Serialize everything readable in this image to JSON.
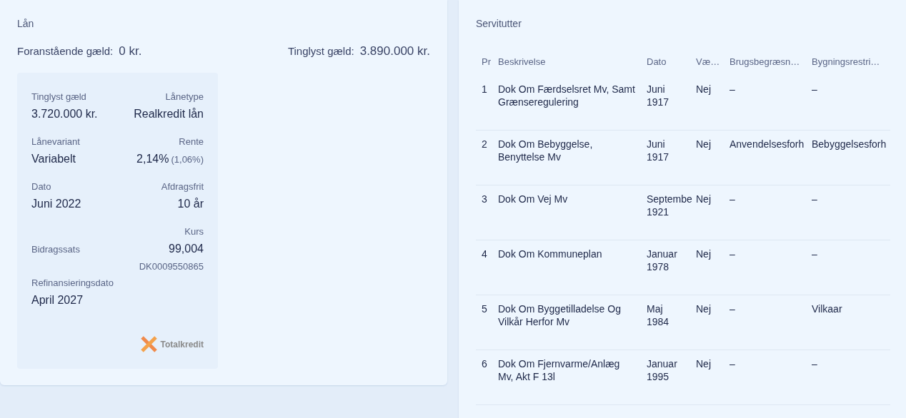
{
  "loan": {
    "title": "Lån",
    "summary": [
      {
        "label": "Foranstående gæld:",
        "value": "0 kr."
      },
      {
        "label": "Tinglyst gæld:",
        "value": "3.890.000 kr."
      }
    ],
    "details": [
      {
        "left": {
          "label": "Tinglyst gæld",
          "value": "3.720.000 kr."
        },
        "right": {
          "label": "Lånetype",
          "value": "Realkredit lån"
        }
      },
      {
        "left": {
          "label": "Lånevariant",
          "value": "Variabelt"
        },
        "right": {
          "label": "Rente",
          "value": "2,14%",
          "note": "(1,06%)"
        }
      },
      {
        "left": {
          "label": "Dato",
          "value": "Juni 2022"
        },
        "right": {
          "label": "Afdragsfrit",
          "value": "10 år"
        }
      },
      {
        "left": {
          "label": "Bidragssats"
        },
        "right": {
          "label": "Kurs",
          "value": "99,004",
          "sub": "DK0009550865"
        }
      },
      {
        "left": {
          "label": "Refinansieringsdato",
          "value": "April 2027"
        }
      }
    ],
    "lender": "Totalkredit"
  },
  "easements": {
    "title": "Servitutter",
    "columns": [
      "Pr",
      "Beskrivelse",
      "Dato",
      "Væ…",
      "Brugsbegræsn…",
      "Bygningsrestri…"
    ],
    "rows": [
      [
        "1",
        "Dok Om Færdselsret Mv, Samt Grænseregulering",
        "Juni 1917",
        "Nej",
        "–",
        "–"
      ],
      [
        "2",
        "Dok Om Bebyggelse, Benyttelse Mv",
        "Juni 1917",
        "Nej",
        "Anvendelsesforh",
        "Bebyggelsesforh"
      ],
      [
        "3",
        "Dok Om Vej Mv",
        "Septembe 1921",
        "Nej",
        "–",
        "–"
      ],
      [
        "4",
        "Dok Om Kommuneplan",
        "Januar 1978",
        "Nej",
        "–",
        "–"
      ],
      [
        "5",
        "Dok Om Byggetilladelse Og Vilkår Herfor Mv",
        "Maj 1984",
        "Nej",
        "–",
        "Vilkaar"
      ],
      [
        "6",
        "Dok Om Fjernvarme/Anlæg Mv, Akt F 13l",
        "Januar 1995",
        "Nej",
        "–",
        "–"
      ]
    ]
  }
}
